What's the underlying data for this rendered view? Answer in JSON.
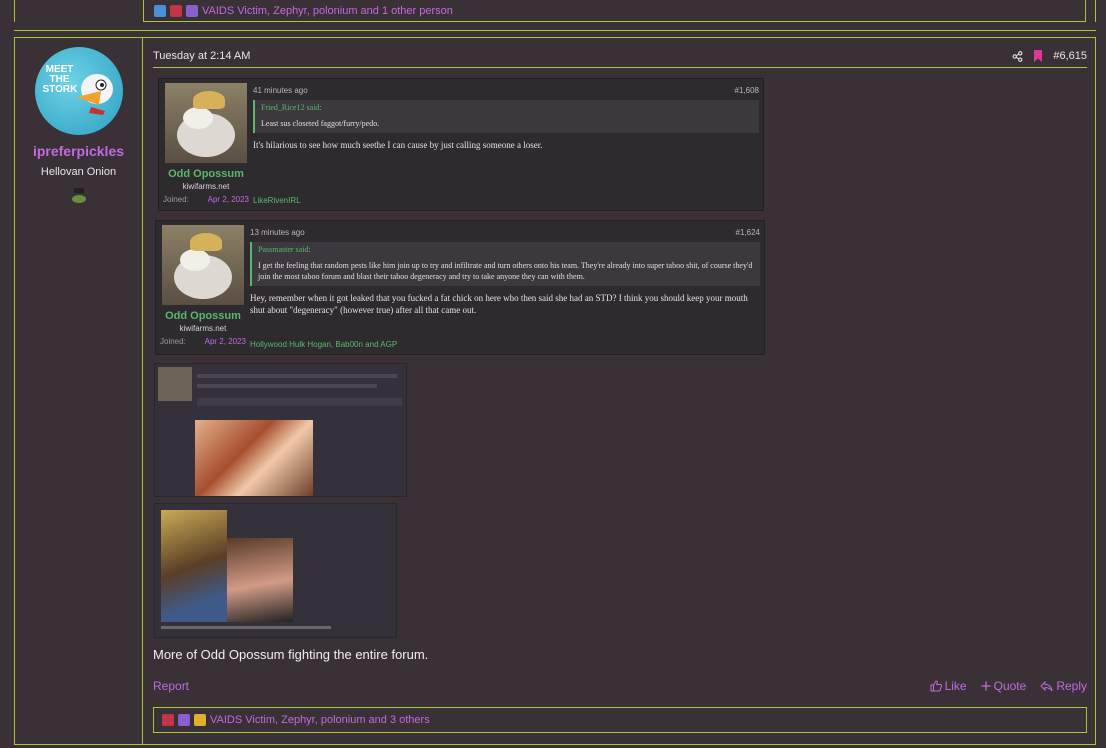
{
  "prev_post": {
    "reactions_text": "VAIDS Victim, Zephyr, polonium and 1 other person"
  },
  "post": {
    "user": {
      "avatar_text": "MEET THE STORK",
      "username": "ipreferpickles",
      "title": "Hellovan Onion"
    },
    "date": "Tuesday at 2:14 AM",
    "post_number": "#6,615",
    "screenshots": [
      {
        "user_name": "Odd Opossum",
        "site": "kiwifarms.net",
        "joined_label": "Joined:",
        "joined_date": "Apr 2, 2023",
        "time_ago": "41 minutes ago",
        "number": "#1,608",
        "quote_author": "Fried_Rice12 said:",
        "quote_text": "Least sus closeted faggot/furry/pedo.",
        "body": "It's hilarious to see how much seethe I can cause by just calling someone a loser.",
        "reactions": "LikeRivenIRL"
      },
      {
        "user_name": "Odd Opossum",
        "site": "kiwifarms.net",
        "joined_label": "Joined:",
        "joined_date": "Apr 2, 2023",
        "time_ago": "13 minutes ago",
        "number": "#1,624",
        "quote_author": "Passmaster said:",
        "quote_text": "I get the feeling that random pests like him join up to try and infiltrate and turn others onto his team. They're already into super taboo shit, of course they'd join the most taboo forum and blast their taboo degeneracy and try to take anyone they can with them.",
        "body": "Hey, remember when it got leaked that you fucked a fat chick on here who then said she had an STD? I think you should keep your mouth shut about \"degeneracy\" (however true) after all that came out.",
        "reactions": "Hollywood Hulk Hogan, Bab00n and AGP"
      }
    ],
    "text": "More of Odd Opossum fighting the entire forum.",
    "report_label": "Report",
    "like_label": "Like",
    "quote_label": "Quote",
    "reply_label": "Reply",
    "reactions_text": "VAIDS Victim, Zephyr, polonium and 3 others"
  },
  "colors": {
    "accent_border": "#a8c43a",
    "link_purple": "#c06be0",
    "username_green": "#59b86e",
    "background": "#3a3136"
  },
  "icons": [
    "share-icon",
    "bookmark-icon",
    "like-icon",
    "quote-icon",
    "reply-icon"
  ]
}
